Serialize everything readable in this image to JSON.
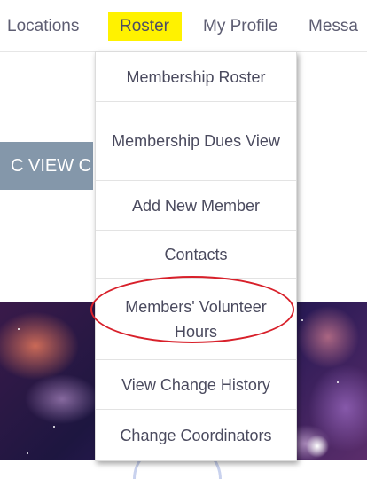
{
  "nav": {
    "items": [
      "Locations",
      "Roster",
      "My Profile",
      "Messa"
    ],
    "highlight_color": "#fff200"
  },
  "button": {
    "label": "C VIEW C"
  },
  "dropdown": {
    "items": [
      "Membership Roster",
      "Membership Dues View",
      "Add New Member",
      "Contacts",
      "Members' Volunteer Hours",
      "View Change History",
      "Change Coordinators"
    ]
  },
  "annotation": {
    "color": "#d8202a"
  }
}
